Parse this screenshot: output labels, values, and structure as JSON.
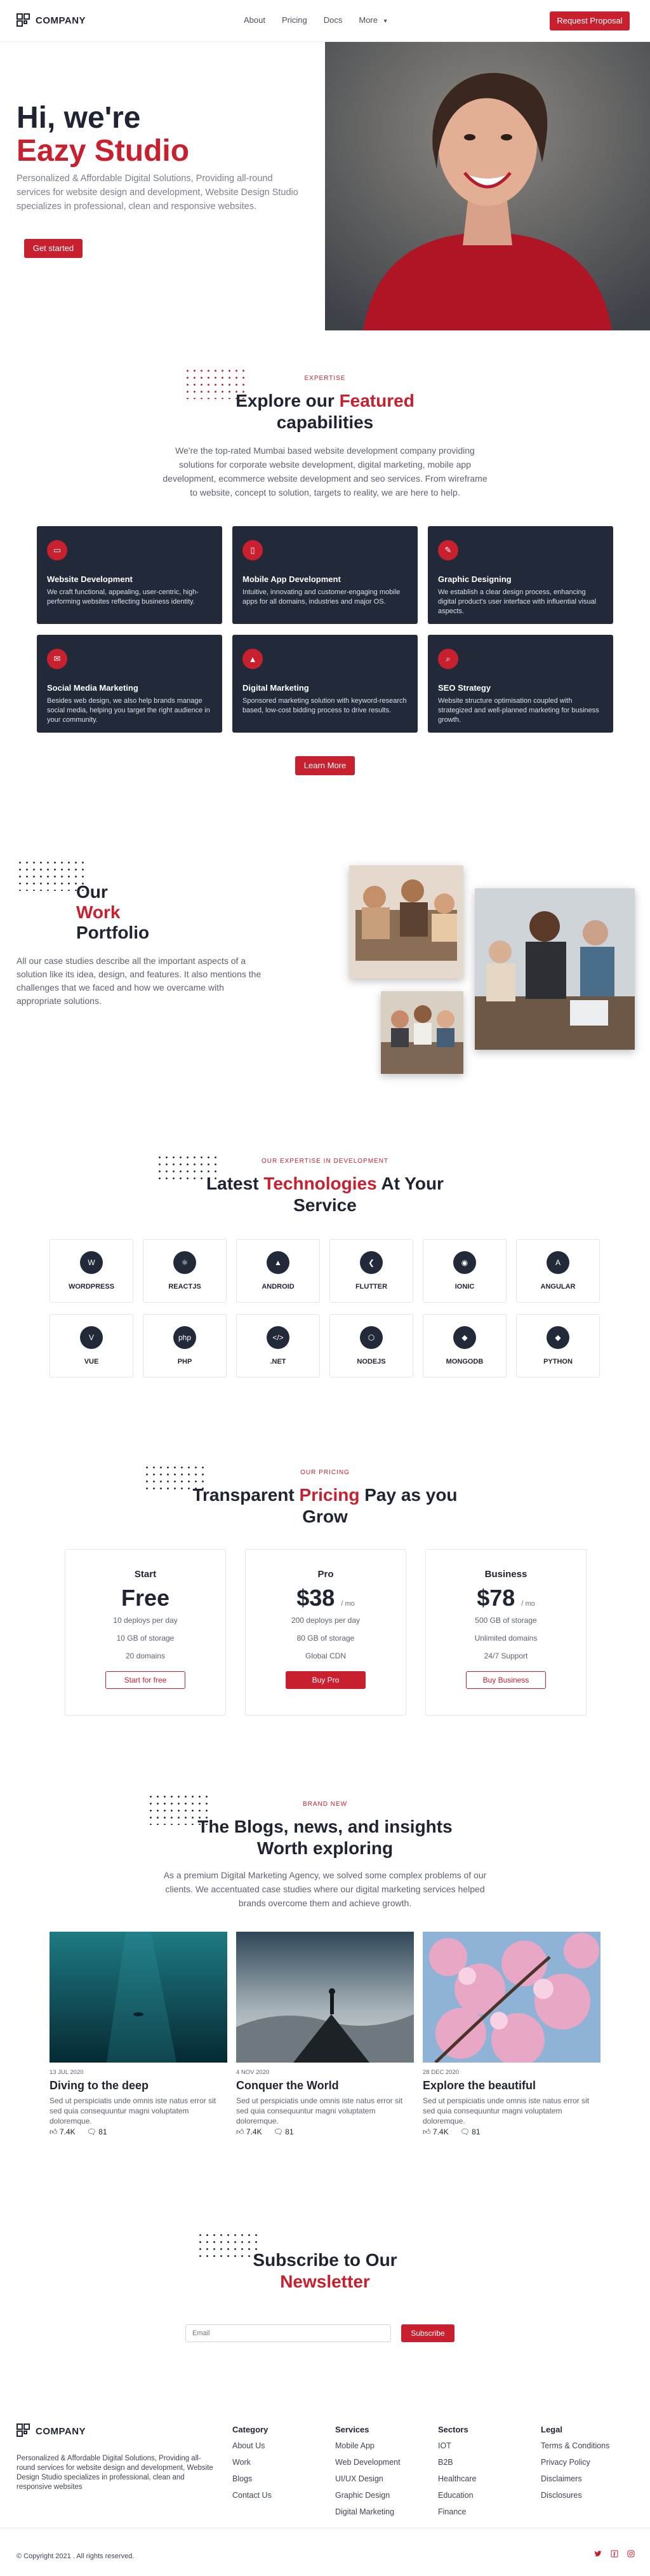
{
  "brand": {
    "name": "COMPANY",
    "accent": "#c8202f",
    "dark": "#222a3a"
  },
  "nav": {
    "links": [
      "About",
      "Pricing",
      "Docs",
      "More"
    ],
    "more_icon": "chevron-down-icon",
    "cta": "Request Proposal"
  },
  "hero": {
    "title_line1": "Hi, we're",
    "title_line2": "Eazy Studio",
    "subtitle": "Personalized & Affordable Digital Solutions, Providing all-round services for website design and development, Website Design Studio specializes in professional, clean and responsive websites.",
    "cta": "Get started"
  },
  "expertise": {
    "tag": "EXPERTISE",
    "title_pre": "Explore our ",
    "title_highlight": "Featured",
    "title_post": "capabilities",
    "description": "We're the top-rated Mumbai based website development company providing solutions for corporate website development, digital marketing, mobile app development, ecommerce website development and seo services. From wireframe to website, concept to solution, targets to reality, we are here to help.",
    "cards": [
      {
        "title": "Website Development",
        "desc": "We craft functional, appealing, user-centric, high-performing websites reflecting business identity.",
        "icon": "monitor-icon"
      },
      {
        "title": "Mobile App Development",
        "desc": "Intuitive, innovating and customer-engaging mobile apps for all domains, industries and major OS.",
        "icon": "mobile-icon"
      },
      {
        "title": "Graphic Designing",
        "desc": "We establish a clear design process, enhancing digital product's user interface with influential visual aspects.",
        "icon": "pen-icon"
      },
      {
        "title": "Social Media Marketing",
        "desc": "Besides web design, we also help brands manage social media, helping you target the right audience in your community.",
        "icon": "chat-icon"
      },
      {
        "title": "Digital Marketing",
        "desc": "Sponsored marketing solution with keyword-research based, low-cost bidding process to drive results.",
        "icon": "chart-icon"
      },
      {
        "title": "SEO Strategy",
        "desc": "Website structure optimisation coupled with strategized and well-planned marketing for business growth.",
        "icon": "search-icon"
      }
    ],
    "cta": "Learn More"
  },
  "portfolio": {
    "title_line1": "Our",
    "title_line2": "Work",
    "title_line3": "Portfolio",
    "description": "All our case studies describe all the important aspects of a solution like its idea, design, and features. It also mentions the challenges that we faced and how we overcame with appropriate solutions."
  },
  "technologies": {
    "tag": "OUR EXPERTISE IN DEVELOPMENT",
    "title_pre": "Latest ",
    "title_highlight": "Technologies",
    "title_post": " At Your",
    "title_line2": "Service",
    "items": [
      {
        "label": "WORDPRESS",
        "glyph": "W"
      },
      {
        "label": "REACTJS",
        "glyph": "⚛"
      },
      {
        "label": "ANDROID",
        "glyph": "▲"
      },
      {
        "label": "FLUTTER",
        "glyph": "❮"
      },
      {
        "label": "IONIC",
        "glyph": "◉"
      },
      {
        "label": "ANGULAR",
        "glyph": "A"
      },
      {
        "label": "VUE",
        "glyph": "V"
      },
      {
        "label": "PHP",
        "glyph": "php"
      },
      {
        "label": ".NET",
        "glyph": "</>"
      },
      {
        "label": "NODEJS",
        "glyph": "⬡"
      },
      {
        "label": "MONGODB",
        "glyph": "◆"
      },
      {
        "label": "PYTHON",
        "glyph": "◆"
      }
    ]
  },
  "pricing": {
    "tag": "OUR PRICING",
    "title_pre": "Transparent ",
    "title_highlight": "Pricing",
    "title_post": " Pay as you",
    "title_line2": "Grow",
    "plans": [
      {
        "name": "Start",
        "price": "Free",
        "unit": "",
        "features": [
          "10 deploys per day",
          "10 GB of storage",
          "20 domains"
        ],
        "cta": "Start for free",
        "style": "outline"
      },
      {
        "name": "Pro",
        "price": "$38",
        "unit": "/ mo",
        "features": [
          "200 deploys per day",
          "80 GB of storage",
          "Global CDN"
        ],
        "cta": "Buy Pro",
        "style": "solid"
      },
      {
        "name": "Business",
        "price": "$78",
        "unit": "/ mo",
        "features": [
          "500 GB of storage",
          "Unlimited domains",
          "24/7 Support"
        ],
        "cta": "Buy Business",
        "style": "outline"
      }
    ]
  },
  "blogs": {
    "tag": "BRAND NEW",
    "title_line1": "The Blogs, news, and insights",
    "title_line2": "Worth exploring",
    "description": "As a premium Digital Marketing Agency, we solved some complex problems of our clients. We accentuated case studies where our digital marketing services helped brands overcome them and achieve growth.",
    "posts": [
      {
        "date": "13 JUL 2020",
        "title": "Diving to the deep",
        "text": "Sed ut perspiciatis unde omnis iste natus error sit sed quia consequuntur magni voluptatem doloremque.",
        "likes": "7.4K",
        "comments": "81"
      },
      {
        "date": "4 NOV 2020",
        "title": "Conquer the World",
        "text": "Sed ut perspiciatis unde omnis iste natus error sit sed quia consequuntur magni voluptatem doloremque.",
        "likes": "7.4K",
        "comments": "81"
      },
      {
        "date": "28 DEC 2020",
        "title": "Explore the beautiful",
        "text": "Sed ut perspiciatis unde omnis iste natus error sit sed quia consequuntur magni voluptatem doloremque.",
        "likes": "7.4K",
        "comments": "81"
      }
    ]
  },
  "newsletter": {
    "title_line1": "Subscribe to Our",
    "title_line2": "Newsletter",
    "placeholder": "Email",
    "cta": "Subscribe"
  },
  "footer": {
    "description": "Personalized & Affordable Digital Solutions, Providing all-round services for website design and development, Website Design Studio specializes in professional, clean and responsive websites",
    "columns": [
      {
        "title": "Category",
        "links": [
          "About Us",
          "Work",
          "Blogs",
          "Contact Us"
        ]
      },
      {
        "title": "Services",
        "links": [
          "Mobile App",
          "Web Development",
          "UI/UX Design",
          "Graphic Design",
          "Digital Marketing"
        ]
      },
      {
        "title": "Sectors",
        "links": [
          "IOT",
          "B2B",
          "Healthcare",
          "Education",
          "Finance"
        ]
      },
      {
        "title": "Legal",
        "links": [
          "Terms & Conditions",
          "Privacy Policy",
          "Disclaimers",
          "Disclosures"
        ]
      }
    ],
    "copyright": "© Copyright 2021 . All rights reserved.",
    "social": [
      "twitter-icon",
      "facebook-icon",
      "instagram-icon"
    ]
  }
}
